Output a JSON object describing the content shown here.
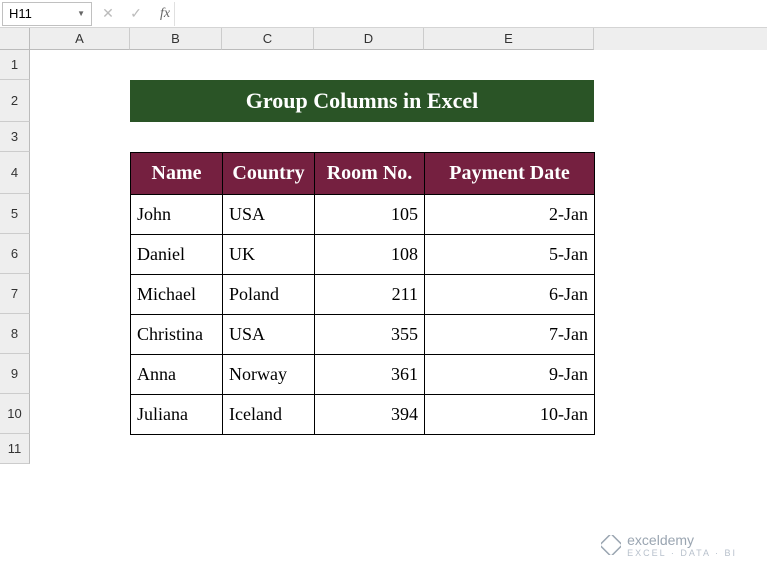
{
  "formula_bar": {
    "name_box_value": "H11",
    "formula_value": "",
    "fx_label": "fx"
  },
  "columns": {
    "A": "A",
    "B": "B",
    "C": "C",
    "D": "D",
    "E": "E"
  },
  "rows": {
    "r1": "1",
    "r2": "2",
    "r3": "3",
    "r4": "4",
    "r5": "5",
    "r6": "6",
    "r7": "7",
    "r8": "8",
    "r9": "9",
    "r10": "10",
    "r11": "11"
  },
  "title_banner": "Group Columns in Excel",
  "table": {
    "headers": {
      "name": "Name",
      "country": "Country",
      "room": "Room No.",
      "payment": "Payment Date"
    },
    "rows": [
      {
        "name": "John",
        "country": "USA",
        "room": "105",
        "payment": "2-Jan"
      },
      {
        "name": "Daniel",
        "country": "UK",
        "room": "108",
        "payment": "5-Jan"
      },
      {
        "name": "Michael",
        "country": "Poland",
        "room": "211",
        "payment": "6-Jan"
      },
      {
        "name": "Christina",
        "country": "USA",
        "room": "355",
        "payment": "7-Jan"
      },
      {
        "name": "Anna",
        "country": "Norway",
        "room": "361",
        "payment": "9-Jan"
      },
      {
        "name": "Juliana",
        "country": "Iceland",
        "room": "394",
        "payment": "10-Jan"
      }
    ]
  },
  "watermark": {
    "main": "exceldemy",
    "sub": "EXCEL · DATA · BI"
  },
  "colors": {
    "title_bg": "#2a5426",
    "header_bg": "#752040",
    "text_white": "#ffffff"
  }
}
